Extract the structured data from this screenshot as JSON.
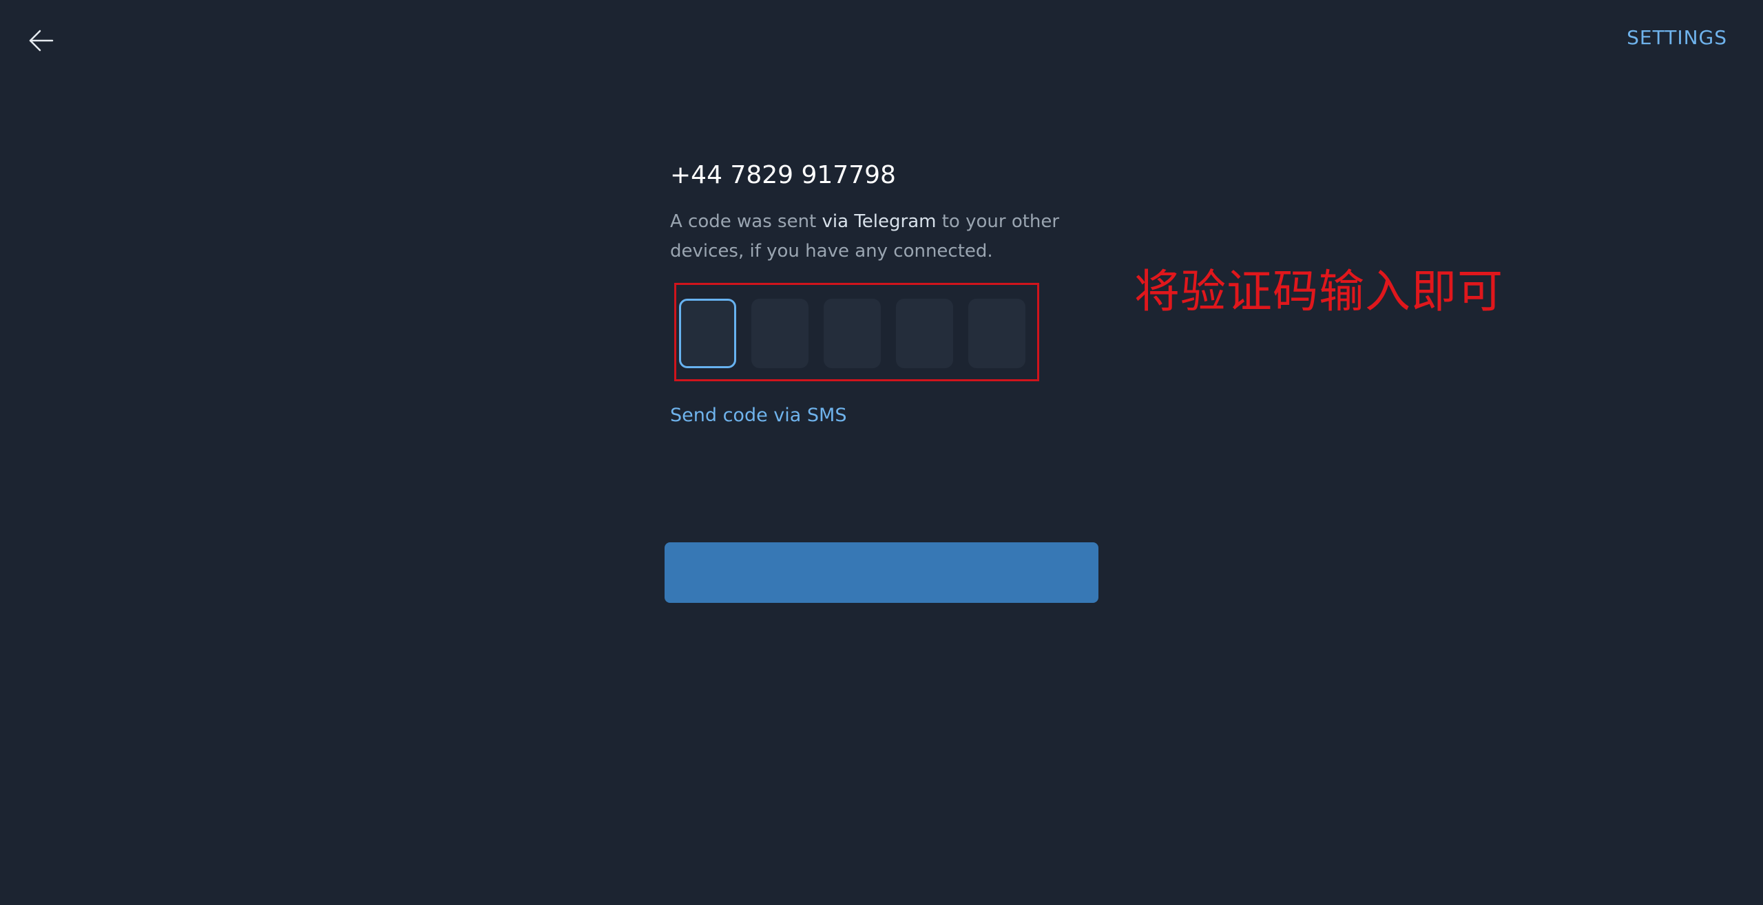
{
  "header": {
    "back_icon": "arrow-left-icon",
    "settings_label": "SETTINGS"
  },
  "auth": {
    "phone_number": "+44 7829 917798",
    "description_part1": "A code was sent ",
    "description_highlight": "via Telegram",
    "description_part2": " to your other devices, if you have any connected.",
    "code_length": 5,
    "active_box_index": 0,
    "sms_link_label": "Send code via SMS",
    "submit_label": ""
  },
  "annotation": {
    "text": "将验证码输入即可",
    "color": "#e0171c"
  },
  "colors": {
    "background": "#1c2431",
    "accent": "#6fb3ec",
    "button": "#3778b5",
    "highlight_border": "#d0141c"
  }
}
